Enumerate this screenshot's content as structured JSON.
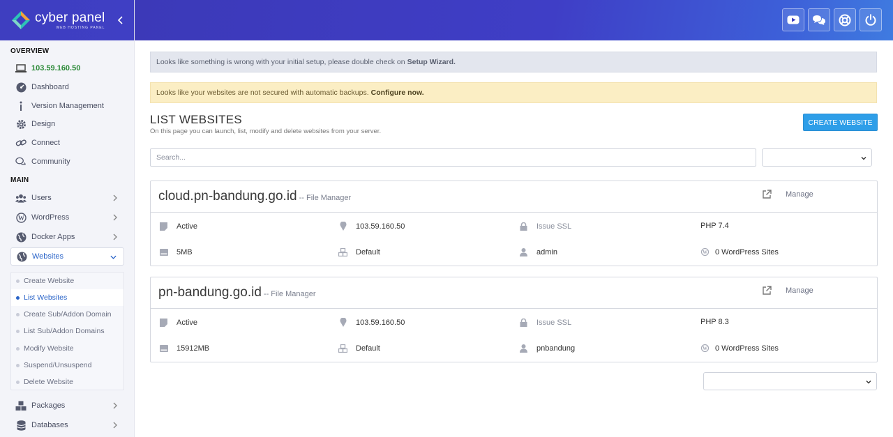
{
  "brand": {
    "name": "cyber panel",
    "tagline": "WEB HOSTING PANEL"
  },
  "sidebar": {
    "overview_title": "OVERVIEW",
    "main_title": "MAIN",
    "overview_items": [
      {
        "label": "103.59.160.50",
        "icon": "laptop-icon"
      },
      {
        "label": "Dashboard",
        "icon": "gauge-icon"
      },
      {
        "label": "Version Management",
        "icon": "info-icon"
      },
      {
        "label": "Design",
        "icon": "gear-icon"
      },
      {
        "label": "Connect",
        "icon": "link-icon"
      },
      {
        "label": "Community",
        "icon": "chat-icon"
      }
    ],
    "main_items": [
      {
        "label": "Users",
        "icon": "users-icon"
      },
      {
        "label": "WordPress",
        "icon": "wordpress-icon"
      },
      {
        "label": "Docker Apps",
        "icon": "globe-icon"
      },
      {
        "label": "Websites",
        "icon": "globe-icon"
      }
    ],
    "websites_submenu": [
      "Create Website",
      "List Websites",
      "Create Sub/Addon Domain",
      "List Sub/Addon Domains",
      "Modify Website",
      "Suspend/Unsuspend",
      "Delete Website"
    ],
    "bottom_items": [
      {
        "label": "Packages",
        "icon": "cubes-icon"
      },
      {
        "label": "Databases",
        "icon": "database-icon"
      }
    ]
  },
  "header": {
    "buttons": [
      "youtube-icon",
      "chat-bubbles-icon",
      "support-icon",
      "power-icon"
    ]
  },
  "alerts": {
    "setup_text": "Looks like something is wrong with your initial setup, please double check on ",
    "setup_link": "Setup Wizard.",
    "backup_text": "Looks like your websites are not secured with automatic backups. ",
    "backup_link": "Configure now."
  },
  "page": {
    "title": "LIST WEBSITES",
    "description": "On this page you can launch, list, modify and delete websites from your server.",
    "create_button": "CREATE WEBSITE",
    "search_placeholder": "Search..."
  },
  "websites": [
    {
      "domain": "cloud.pn-bandung.go.id",
      "file_manager": "-- File Manager",
      "manage": "Manage",
      "status": "Active",
      "ip": "103.59.160.50",
      "ssl": "Issue SSL",
      "php": "PHP 7.4",
      "disk": "5MB",
      "package": "Default",
      "owner": "admin",
      "wp_sites": "0 WordPress Sites"
    },
    {
      "domain": "pn-bandung.go.id",
      "file_manager": "-- File Manager",
      "manage": "Manage",
      "status": "Active",
      "ip": "103.59.160.50",
      "ssl": "Issue SSL",
      "php": "PHP 8.3",
      "disk": "15912MB",
      "package": "Default",
      "owner": "pnbandung",
      "wp_sites": "0 WordPress Sites"
    }
  ],
  "colors": {
    "header": "#3e3ec0",
    "accent": "#2e9ee8",
    "ip_green": "#2e8b3a",
    "active_blue": "#2a64c8"
  }
}
